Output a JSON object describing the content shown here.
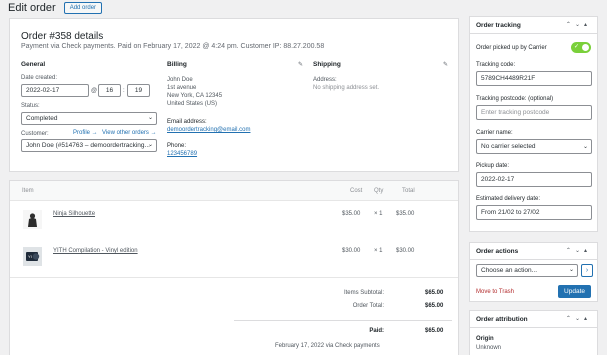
{
  "header": {
    "title": "Edit order",
    "add_order": "Add order"
  },
  "order": {
    "title": "Order #358 details",
    "subtitle": "Payment via Check payments. Paid on February 17, 2022 @ 4:24 pm. Customer IP: 88.27.200.58",
    "general": {
      "heading": "General",
      "date_label": "Date created:",
      "date": "2022-02-17",
      "at": "@",
      "hour": "16",
      "minute": "19",
      "status_label": "Status:",
      "status": "Completed",
      "customer_label": "Customer:",
      "profile_link": "Profile →",
      "other_orders_link": "View other orders →",
      "customer": "John Doe (#514763 – demoordertracking..."
    },
    "billing": {
      "heading": "Billing",
      "address": [
        "John Doe",
        "1st avenue",
        "New York, CA 12345",
        "United States (US)"
      ],
      "email_label": "Email address:",
      "email": "demoordertracking@email.com",
      "phone_label": "Phone:",
      "phone": "123456789"
    },
    "shipping": {
      "heading": "Shipping",
      "address_label": "Address:",
      "address": "No shipping address set."
    }
  },
  "items": {
    "columns": {
      "item": "Item",
      "cost": "Cost",
      "qty": "Qty",
      "total": "Total"
    },
    "rows": [
      {
        "name": "Ninja Silhouette",
        "cost": "$35.00",
        "qty": "× 1",
        "total": "$35.00"
      },
      {
        "name": "YITH Compilation - Vinyl edition",
        "cost": "$30.00",
        "qty": "× 1",
        "total": "$30.00"
      }
    ],
    "subtotal_label": "Items Subtotal:",
    "subtotal": "$65.00",
    "order_total_label": "Order Total:",
    "order_total": "$65.00",
    "paid_label": "Paid:",
    "paid": "$65.00",
    "paid_note": "February 17, 2022 via Check payments"
  },
  "tracking": {
    "title": "Order tracking",
    "picked_label": "Order picked up by Carrier",
    "picked": true,
    "code_label": "Tracking code:",
    "code": "5789CH4489R21F",
    "postcode_label": "Tracking postcode: (optional)",
    "postcode_placeholder": "Enter tracking postcode",
    "carrier_label": "Carrier name:",
    "carrier": "No carrier selected",
    "pickup_label": "Pickup date:",
    "pickup": "2022-02-17",
    "delivery_label": "Estimated delivery date:",
    "delivery": "From 21/02 to 27/02"
  },
  "actions": {
    "title": "Order actions",
    "choose": "Choose an action...",
    "trash": "Move to Trash",
    "update": "Update"
  },
  "attribution": {
    "title": "Order attribution",
    "origin_label": "Origin",
    "origin": "Unknown"
  },
  "colors": {
    "accent": "#2271b1",
    "toggle_on": "#7ad03a",
    "trash": "#b32d2e"
  }
}
